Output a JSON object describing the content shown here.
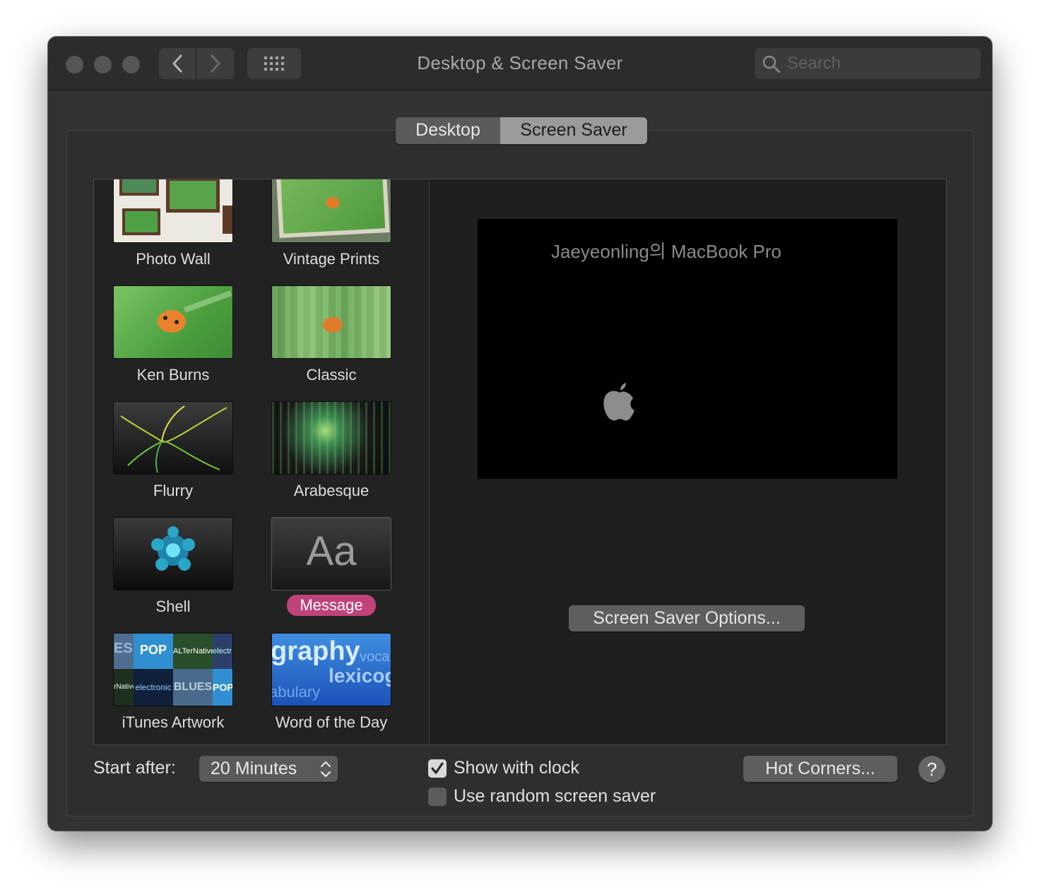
{
  "window": {
    "title": "Desktop & Screen Saver",
    "search_placeholder": "Search"
  },
  "tabs": {
    "desktop": "Desktop",
    "screen_saver": "Screen Saver",
    "active": "Screen Saver"
  },
  "savers": [
    {
      "label": "Photo Wall",
      "selected": false
    },
    {
      "label": "Vintage Prints",
      "selected": false
    },
    {
      "label": "Ken Burns",
      "selected": false
    },
    {
      "label": "Classic",
      "selected": false
    },
    {
      "label": "Flurry",
      "selected": false
    },
    {
      "label": "Arabesque",
      "selected": false
    },
    {
      "label": "Shell",
      "selected": false
    },
    {
      "label": "Message",
      "selected": true
    },
    {
      "label": "iTunes Artwork",
      "selected": false
    },
    {
      "label": "Word of the Day",
      "selected": false
    }
  ],
  "thumb_text": {
    "message_glyph": "Aa",
    "word_main": "graphy",
    "word_2": "lexicog",
    "word_3": "abulary",
    "word_4": "voca",
    "itunes_pop": "POP",
    "itunes_alt": "ALTerNative",
    "itunes_elec": "electronic",
    "itunes_blues": "BLUES",
    "itunes_es": "ES",
    "itunes_native": "rNative",
    "itunes_elec2": "electr"
  },
  "preview": {
    "message": "Jaeyeonling의 MacBook Pro"
  },
  "buttons": {
    "options": "Screen Saver Options...",
    "hot_corners": "Hot Corners...",
    "help": "?"
  },
  "start_after": {
    "label": "Start after:",
    "value": "20 Minutes"
  },
  "checkboxes": {
    "show_with_clock": {
      "label": "Show with clock",
      "checked": true
    },
    "random": {
      "label": "Use random screen saver",
      "checked": false
    }
  },
  "colors": {
    "selection_pill": "#c0437a",
    "window_bg": "#323232"
  }
}
